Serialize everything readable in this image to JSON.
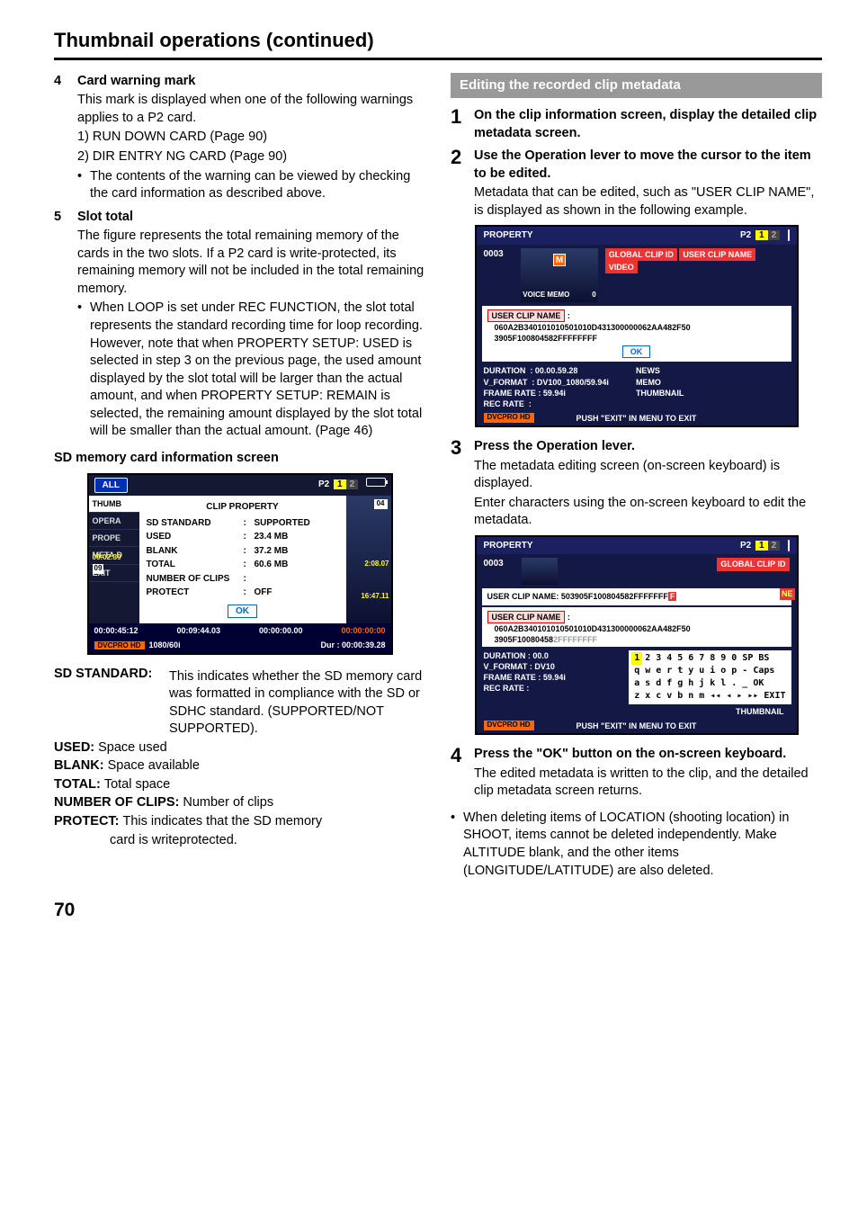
{
  "page_title": "Thumbnail operations (continued)",
  "page_number": "70",
  "left": {
    "item4": {
      "num": "4",
      "title": "Card warning mark",
      "p1": "This mark is displayed when one of the following warnings applies to a P2 card.",
      "l1": "1) RUN DOWN CARD (Page 90)",
      "l2": "2) DIR ENTRY NG CARD (Page 90)",
      "bullet": "The contents of the warning can be viewed by checking the card information as described above."
    },
    "item5": {
      "num": "5",
      "title": "Slot total",
      "p1": "The figure represents the total remaining memory of the cards in the two slots. If a P2 card is write-protected, its remaining memory will not be included in the total remaining memory.",
      "bullet": "When LOOP is set under REC FUNCTION, the slot total represents the standard recording time for loop recording. However, note that when PROPERTY SETUP: USED is selected in step 3 on the previous page, the used amount displayed by the slot total will be larger than the actual amount, and when PROPERTY SETUP: REMAIN is selected, the remaining amount displayed by the slot total will be smaller than the actual amount. (Page 46)"
    },
    "sd_heading": "SD memory card information screen",
    "shot1": {
      "all": "ALL",
      "p2": "P2",
      "slot1": "1",
      "slot2": "2",
      "tabs": [
        "THUMB",
        "OPERA",
        "PROPE",
        "META D",
        "EXIT"
      ],
      "panel_title": "CLIP PROPERTY",
      "rows": [
        {
          "k": "SD STANDARD",
          "v": "SUPPORTED"
        },
        {
          "k": "USED",
          "v": "23.4 MB"
        },
        {
          "k": "BLANK",
          "v": "37.2 MB"
        },
        {
          "k": "TOTAL",
          "v": "60.6 MB"
        },
        {
          "k": "NUMBER OF CLIPS",
          "v": ""
        },
        {
          "k": "PROTECT",
          "v": "OFF"
        }
      ],
      "ok": "OK",
      "corner1": "04",
      "sidetime1": "2:08.07",
      "sidetime2": "16:47.11",
      "lefttime": "00:02:39",
      "leftbadge": "09",
      "tc1": "00:00:45:12",
      "tc2": "00:09:44.03",
      "tc3": "00:00:00.00",
      "tc4": "00:00:00:00",
      "dvcpro": "DVCPRO HD",
      "mode": "1080/60i",
      "dur": "Dur : 00:00:39.28"
    },
    "defs": {
      "sd_standard_k": "SD STANDARD:",
      "sd_standard_v": "This indicates whether the SD memory card was formatted in compliance with the SD or SDHC standard. (SUPPORTED/NOT SUPPORTED).",
      "used_k": "USED:",
      "used_v": "Space used",
      "blank_k": "BLANK:",
      "blank_v": "Space available",
      "total_k": "TOTAL:",
      "total_v": "Total space",
      "noc_k": "NUMBER OF CLIPS:",
      "noc_v": "Number of clips",
      "protect_k": "PROTECT:",
      "protect_v1": "This indicates that the SD memory",
      "protect_v2": "card is writeprotected."
    }
  },
  "right": {
    "section_title": "Editing the recorded clip metadata",
    "step1": {
      "num": "1",
      "title": "On the clip information screen, display the detailed clip metadata screen."
    },
    "step2": {
      "num": "2",
      "title": "Use the Operation lever to move the cursor to the item to be edited.",
      "body": "Metadata that can be edited, such as \"USER CLIP NAME\", is displayed as shown in the following example."
    },
    "shot2": {
      "property": "PROPERTY",
      "p2": "P2",
      "slot1": "1",
      "slot2": "2",
      "clipid": "0003",
      "m": "M",
      "voice_memo": "VOICE MEMO",
      "voice_memo_n": "0",
      "meta": [
        "GLOBAL CLIP ID",
        "USER CLIP NAME",
        "VIDEO"
      ],
      "ucn_label": "USER CLIP NAME",
      "ucn_line1": "060A2B340101010501010D431300000062AA482F50",
      "ucn_line2": "3905F100804582FFFFFFFF",
      "ok": "OK",
      "duration_k": "DURATION",
      "duration_v": ": 00.00.59.28",
      "vformat_k": "V_FORMAT",
      "vformat_v": ": DV100_1080/59.94i",
      "frate_k": "FRAME RATE",
      "frate_v": ": 59.94i",
      "rrate_k": "REC RATE",
      "rrate_v": ":",
      "rcol": [
        "NEWS",
        "MEMO",
        "THUMBNAIL"
      ],
      "exit": "PUSH \"EXIT\" IN MENU TO EXIT",
      "dvcpro": "DVCPRO HD"
    },
    "step3": {
      "num": "3",
      "title": "Press the Operation lever.",
      "body1": "The metadata editing screen (on-screen keyboard) is displayed.",
      "body2": "Enter characters using the on-screen keyboard to edit the metadata."
    },
    "shot3": {
      "property": "PROPERTY",
      "p2": "P2",
      "slot1": "1",
      "slot2": "2",
      "clipid": "0003",
      "gci": "GLOBAL CLIP ID",
      "ne": "NE",
      "ucnbar": "USER CLIP NAME: 503905F100804582FFFFFFF",
      "ucnbar_cursor": "F",
      "ucn_label": "USER CLIP NAME",
      "ucn_line1": "060A2B340101010501010D431300000062AA482F50",
      "ucn_line2": "3905F10080458",
      "ucn_line2_tail": "2FFFFFFFF",
      "row1": [
        "1",
        "2",
        "3",
        "4",
        "5",
        "6",
        "7",
        "8",
        "9",
        "0",
        "SP",
        "BS"
      ],
      "row2": [
        "q",
        "w",
        "e",
        "r",
        "t",
        "y",
        "u",
        "i",
        "o",
        "p",
        "-",
        "Caps"
      ],
      "row3": [
        "a",
        "s",
        "d",
        "f",
        "g",
        "h",
        "j",
        "k",
        "l",
        ".",
        "_",
        "OK"
      ],
      "row4": [
        "z",
        "x",
        "c",
        "v",
        "b",
        "n",
        "m",
        "◂◂",
        "◂",
        "▸",
        "▸▸",
        "EXIT"
      ],
      "duration_k": "DURATION",
      "duration_v": ": 00.0",
      "vformat_k": "V_FORMAT",
      "vformat_v": ": DV10",
      "frate_k": "FRAME RATE",
      "frate_v": ": 59.94i",
      "rrate_k": "REC RATE",
      "rrate_v": ":",
      "thumb": "THUMBNAIL",
      "exit": "PUSH \"EXIT\" IN MENU TO EXIT",
      "dvcpro": "DVCPRO HD"
    },
    "step4": {
      "num": "4",
      "title": "Press the \"OK\" button on the on-screen keyboard.",
      "body": "The edited metadata is written to the clip, and the detailed clip metadata screen returns."
    },
    "note": "When deleting items of LOCATION (shooting location) in SHOOT, items cannot be deleted independently. Make ALTITUDE blank, and the other items (LONGITUDE/LATITUDE) are also deleted."
  }
}
